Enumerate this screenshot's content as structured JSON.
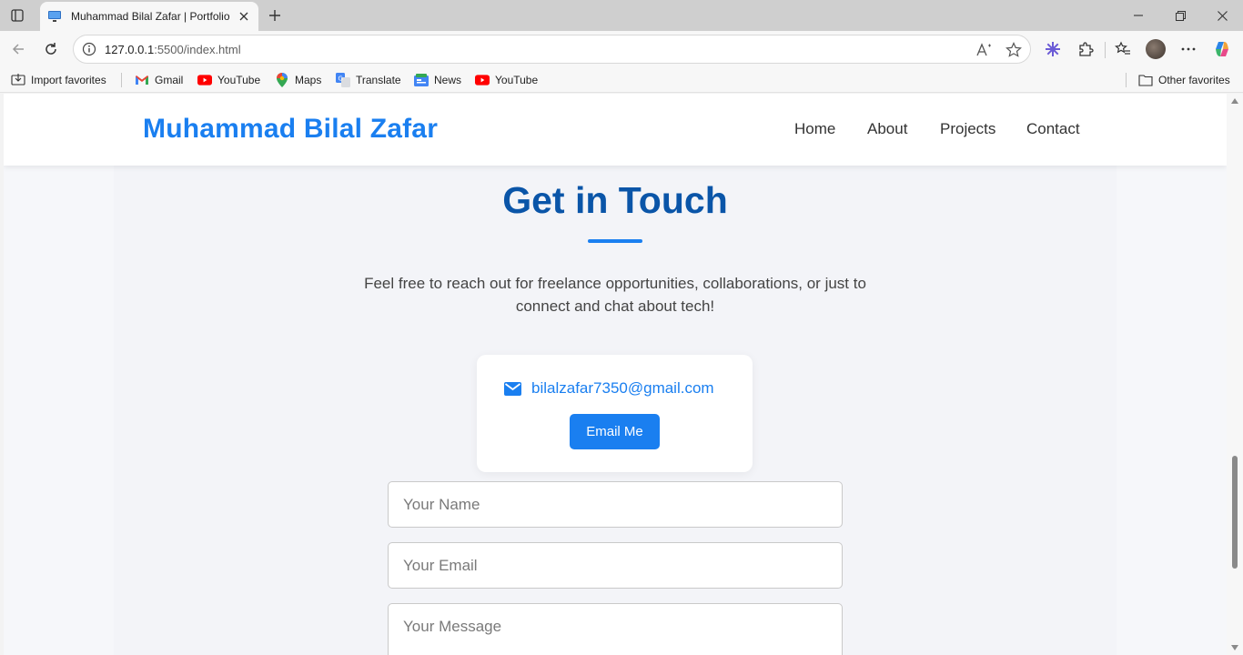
{
  "browser": {
    "tab_title": "Muhammad Bilal Zafar | Portfolio",
    "url_host": "127.0.0.1",
    "url_rest": ":5500/index.html",
    "bookmarks": {
      "import": "Import favorites",
      "gmail": "Gmail",
      "youtube1": "YouTube",
      "maps": "Maps",
      "translate": "Translate",
      "news": "News",
      "youtube2": "YouTube",
      "other": "Other favorites"
    }
  },
  "site": {
    "brand": "Muhammad Bilal Zafar",
    "nav": {
      "home": "Home",
      "about": "About",
      "projects": "Projects",
      "contact": "Contact"
    }
  },
  "contact": {
    "heading": "Get in Touch",
    "intro": "Feel free to reach out for freelance opportunities, collaborations, or just to connect and chat about tech!",
    "email": "bilalzafar7350@gmail.com",
    "email_button": "Email Me",
    "form": {
      "name_placeholder": "Your Name",
      "email_placeholder": "Your Email",
      "message_placeholder": "Your Message"
    }
  },
  "colors": {
    "accent": "#1a7ff0",
    "heading": "#0a55a8"
  }
}
